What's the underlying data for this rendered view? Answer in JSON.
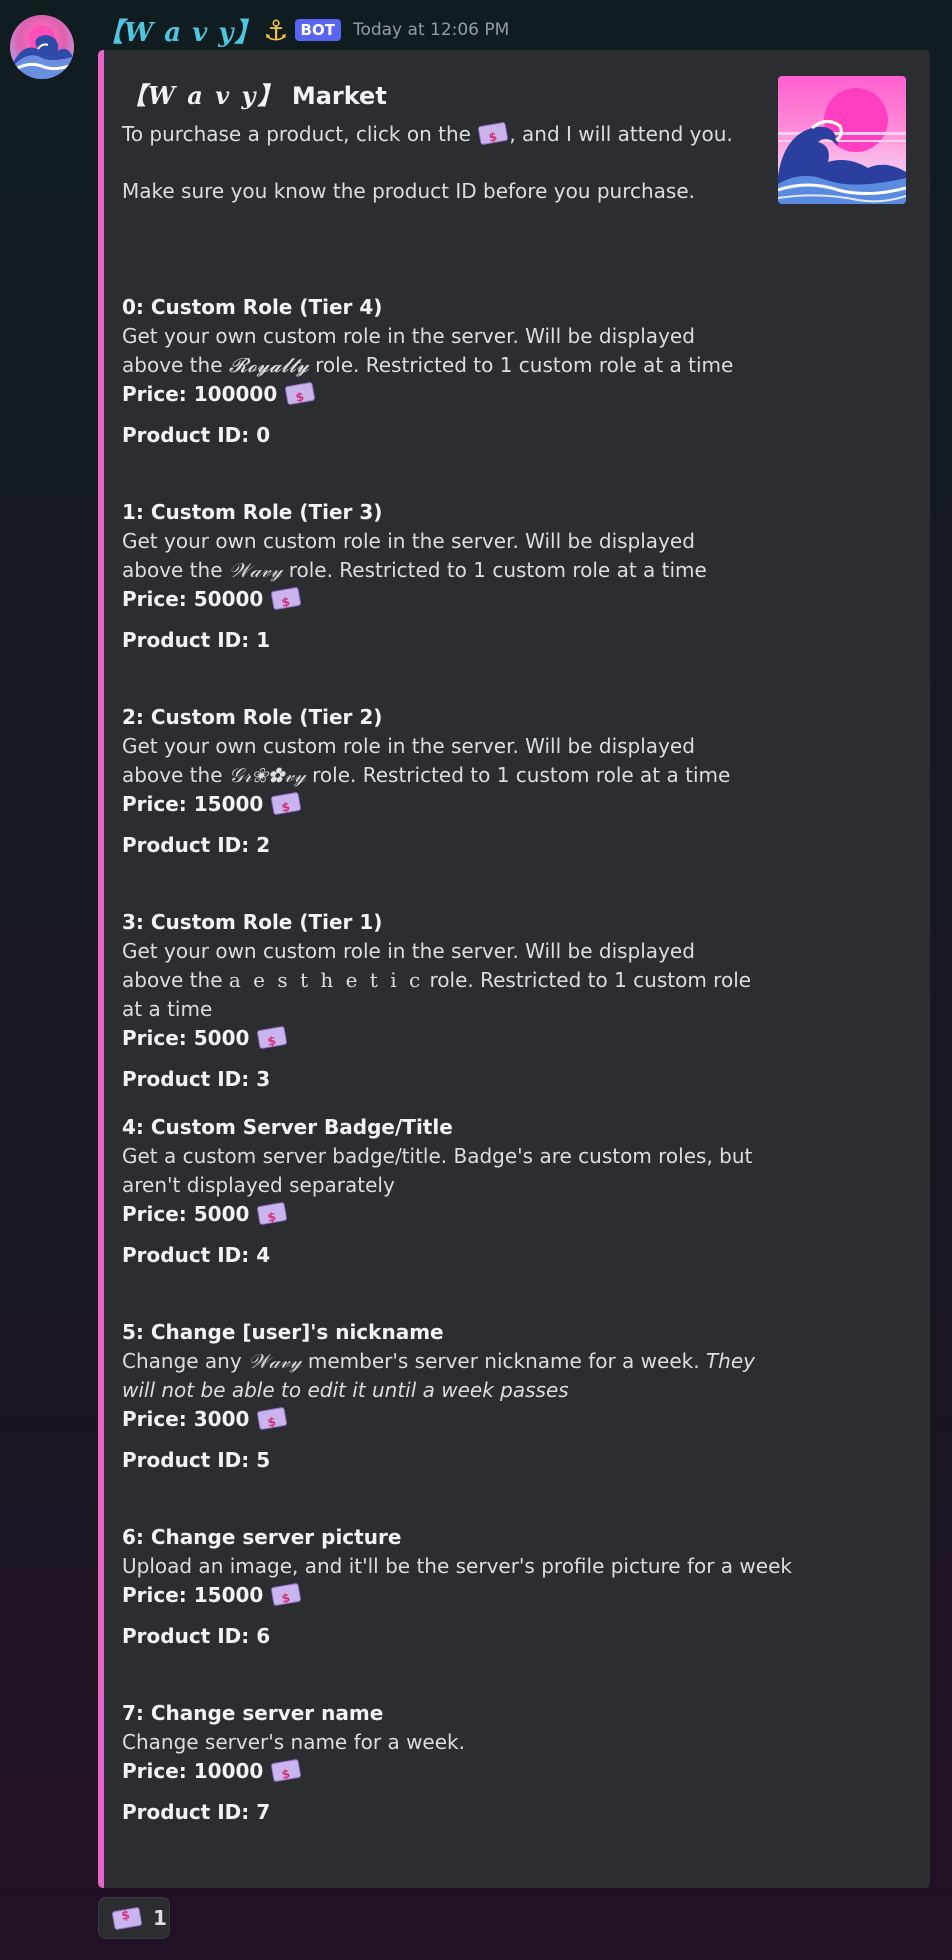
{
  "message": {
    "author_name": "【𝑾 𝒂 𝒗 𝒚】",
    "author_icon": "anchor-icon",
    "bot_label": "BOT",
    "timestamp": "Today at 12:06 PM"
  },
  "embed": {
    "title_brand": "【𝑾 𝒂 𝒗 𝒚】",
    "title_text": "Market",
    "accent_color": "#e864c8",
    "desc_line1_before": "To purchase a product, click on the",
    "desc_line1_after": ", and I will attend you.",
    "desc_line2": "Make sure you know the product ID before you purchase.",
    "products": [
      {
        "title": "0: Custom Role (Tier 4)",
        "desc_before": "Get your own custom role in the server. Will be displayed above the",
        "role": "𝓡𝓸𝔂𝓪𝓵𝓽𝔂",
        "desc_after": "role. Restricted to 1 custom role at a time",
        "price": "Price: 100000",
        "id": "Product ID: 0"
      },
      {
        "title": "1: Custom Role (Tier 3)",
        "desc_before": "Get your own custom role in the server. Will be displayed above the",
        "role": "𝒲𝒶𝓋𝓎",
        "desc_after": "role. Restricted to 1 custom role at a time",
        "price": "Price: 50000",
        "id": "Product ID: 1"
      },
      {
        "title": "2: Custom Role (Tier 2)",
        "desc_before": "Get your own custom role in the server. Will be displayed above the",
        "role": "𝒢𝓇❀✿𝓋𝓎",
        "desc_after": "role. Restricted to 1 custom role at a time",
        "price": "Price: 15000",
        "id": "Product ID: 2"
      },
      {
        "title": "3: Custom Role (Tier 1)",
        "desc_before": "Get your own custom role in the server. Will be displayed above the",
        "role": "a e s t h e t i c",
        "desc_after": "role. Restricted to 1 custom role at a time",
        "price": "Price: 5000",
        "id": "Product ID: 3"
      },
      {
        "title": "4: Custom Server Badge/Title",
        "desc": "Get a custom server badge/title. Badge's are custom roles, but aren't displayed separately",
        "price": "Price: 5000",
        "id": "Product ID: 4"
      },
      {
        "title": "5: Change [user]'s nickname",
        "desc_before": "Change any",
        "role": "𝒲𝒶𝓋𝓎",
        "desc_after": "member's server nickname for a week.",
        "desc_italic": "They will not be able to edit it until a week passes",
        "price": "Price: 3000",
        "id": "Product ID: 5"
      },
      {
        "title": "6: Change server picture",
        "desc": "Upload an image, and it'll be the server's profile picture for a week",
        "price": "Price: 15000",
        "id": "Product ID: 6"
      },
      {
        "title": "7: Change server name",
        "desc": "Change server's name for a week.",
        "price": "Price: 10000",
        "id": "Product ID: 7"
      }
    ]
  },
  "reaction": {
    "icon": "money-icon",
    "count": "1"
  }
}
